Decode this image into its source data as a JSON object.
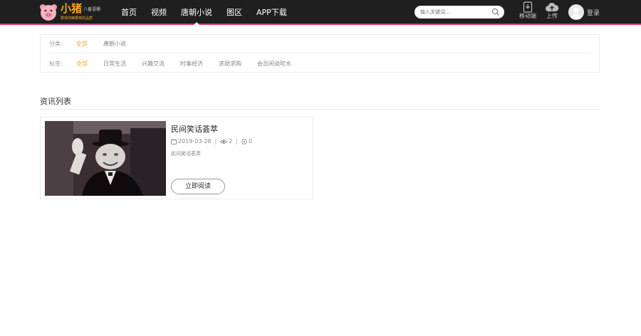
{
  "header": {
    "brand": "小猪",
    "brand_sub": "八番语桶",
    "slogan": "要现你精要离的品质",
    "nav": [
      {
        "label": "首页",
        "active": false
      },
      {
        "label": "视频",
        "active": false
      },
      {
        "label": "唐朝小说",
        "active": true
      },
      {
        "label": "图区",
        "active": false
      },
      {
        "label": "APP下载",
        "active": false
      }
    ],
    "search_placeholder": "输入关键词...",
    "mobile_label": "移动端",
    "upload_label": "上传",
    "login_label": "登录",
    "accent_color": "#d6336c",
    "brand_color": "#f5a623"
  },
  "filters": {
    "category_label": "分类:",
    "categories": [
      "全部",
      "唐朝小说"
    ],
    "tag_label": "标签:",
    "tags": [
      "全部",
      "日常生活",
      "兴趣交流",
      "时事经济",
      "求助求购",
      "会员闲谈吹水"
    ]
  },
  "section": {
    "title": "资讯列表"
  },
  "articles": [
    {
      "title": "民间笑话荟萃",
      "date": "2019-03-28",
      "views": "2",
      "comments": "0",
      "desc": "民间笑话荟萃",
      "button": "立即阅读"
    }
  ]
}
